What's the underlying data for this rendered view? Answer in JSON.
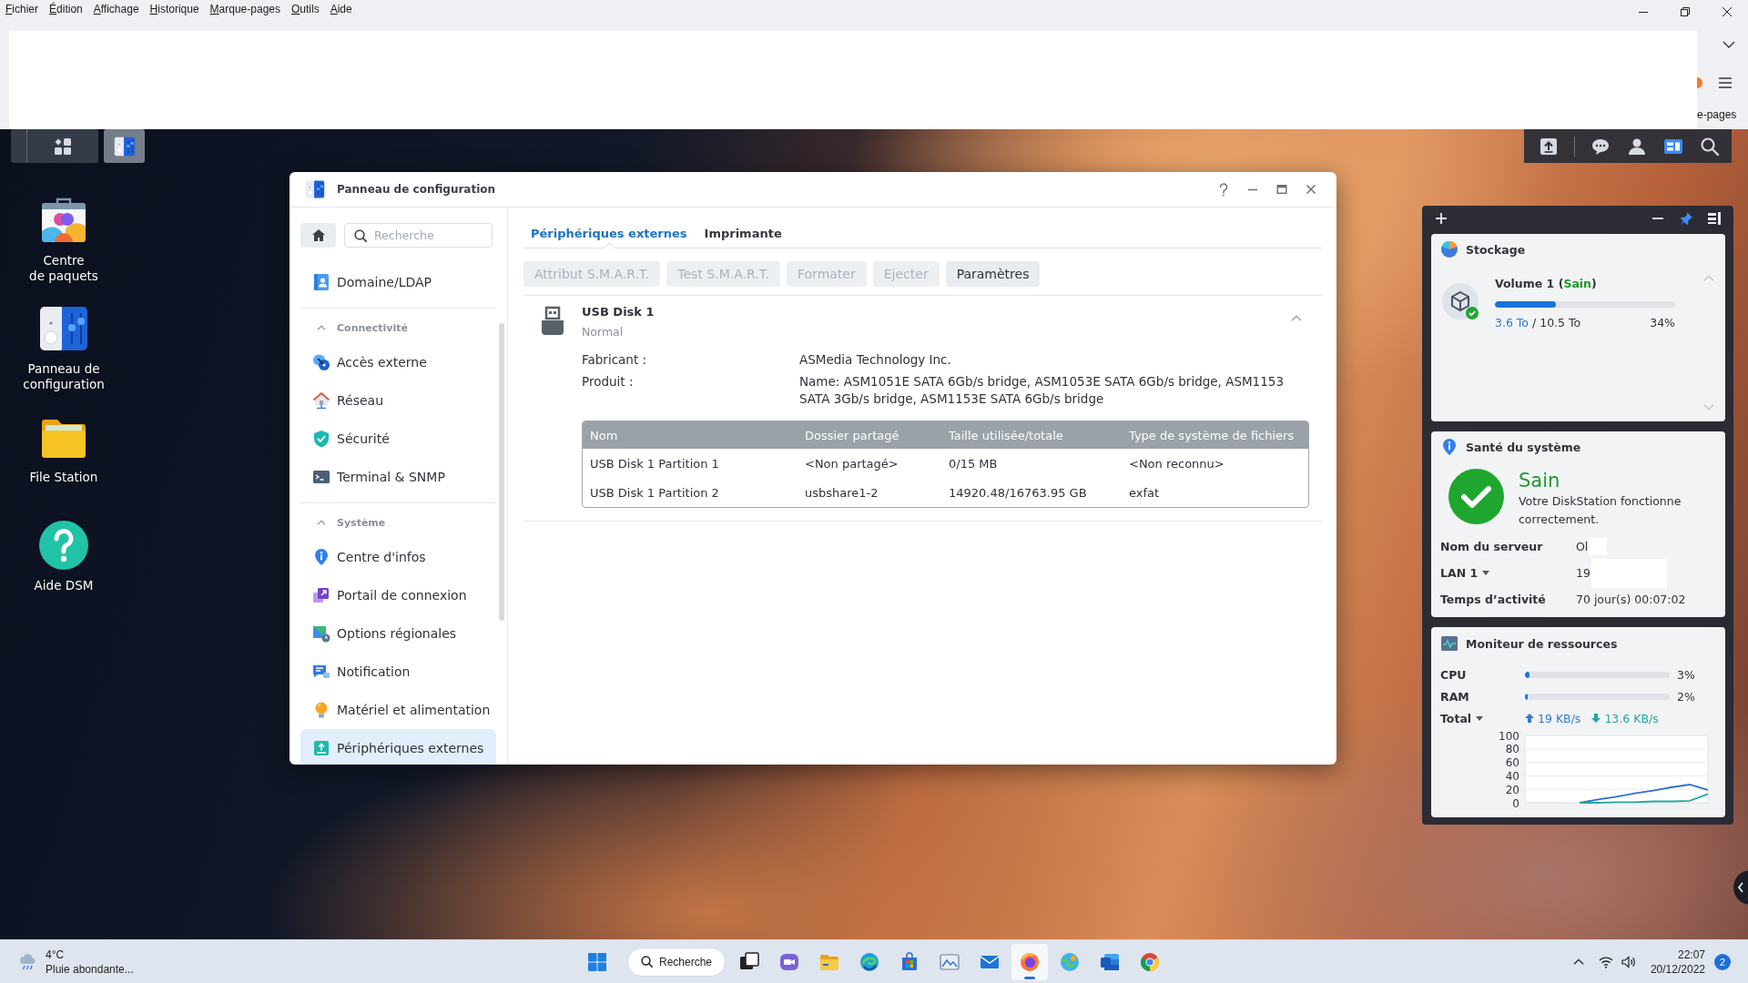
{
  "browser": {
    "menu": [
      "Fichier",
      "Édition",
      "Affichage",
      "Historique",
      "Marque-pages",
      "Outils",
      "Aide"
    ],
    "bookmarks_overflow": "e-pages"
  },
  "dsm_taskbar": {
    "open_windows": [
      {
        "active": true
      }
    ],
    "tray": [
      {
        "active": false
      },
      {
        "active": false
      },
      {
        "active": false
      },
      {
        "active": true
      },
      {
        "active": false
      }
    ]
  },
  "desktop_icons": [
    {
      "label": "Centre\nde paquets"
    },
    {
      "label": "Panneau de\nconfiguration"
    },
    {
      "label": "File Station"
    },
    {
      "label": "Aide DSM"
    }
  ],
  "control_panel": {
    "title": "Panneau de configuration",
    "search": {
      "placeholder": "Recherche"
    },
    "sidebar": [
      {
        "kind": "item",
        "label": "Domaine/LDAP",
        "selected": false
      },
      {
        "kind": "section",
        "label": "Connectivité",
        "expanded": true,
        "children": [
          {
            "label": "Accès externe",
            "selected": false
          },
          {
            "label": "Réseau",
            "selected": false
          },
          {
            "label": "Sécurité",
            "selected": false
          },
          {
            "label": "Terminal & SNMP",
            "selected": false
          }
        ]
      },
      {
        "kind": "section",
        "label": "Système",
        "expanded": true,
        "children": [
          {
            "label": "Centre d'infos",
            "selected": false
          },
          {
            "label": "Portail de connexion",
            "selected": false
          },
          {
            "label": "Options régionales",
            "selected": false
          },
          {
            "label": "Notification",
            "selected": false
          },
          {
            "label": "Matériel et alimentation",
            "selected": false
          },
          {
            "label": "Périphériques externes",
            "selected": true
          }
        ]
      }
    ],
    "tabs": [
      {
        "label": "Périphériques externes",
        "selected": true
      },
      {
        "label": "Imprimante",
        "selected": false
      }
    ],
    "toolbar": [
      {
        "label": "Attribut S.M.A.R.T.",
        "disabled": true
      },
      {
        "label": "Test S.M.A.R.T.",
        "disabled": true
      },
      {
        "label": "Formater",
        "disabled": true
      },
      {
        "label": "Ejecter",
        "disabled": true
      },
      {
        "label": "Paramètres",
        "disabled": false
      }
    ],
    "device": {
      "name": "USB Disk 1",
      "status": "Normal",
      "expanded": true,
      "details": [
        {
          "label": "Fabricant :",
          "value": "ASMedia Technology Inc."
        },
        {
          "label": "Produit :",
          "value": "Name: ASM1051E SATA 6Gb/s bridge, ASM1053E SATA 6Gb/s bridge, ASM1153 SATA 3Gb/s bridge, ASM1153E SATA 6Gb/s bridge"
        }
      ],
      "table": {
        "columns": [
          "Nom",
          "Dossier partagé",
          "Taille utilisée/totale",
          "Type de système de fichiers"
        ],
        "rows": [
          [
            "USB Disk 1 Partition 1",
            "<Non partagé>",
            "0/15 MB",
            "<Non reconnu>"
          ],
          [
            "USB Disk 1 Partition 2",
            "usbshare1-2",
            "14920.48/16763.95 GB",
            "exfat"
          ]
        ]
      }
    }
  },
  "widgets": {
    "storage": {
      "title": "Stockage",
      "volumes": [
        {
          "name": "Volume 1 (",
          "status": "Sain",
          "status_end": ")",
          "healthy": true,
          "level": 0.34,
          "used": "3.6 To",
          "separator": "/",
          "total": "10.5 To",
          "percent": "34%"
        }
      ]
    },
    "health": {
      "title": "Santé du système",
      "healthy": true,
      "status": "Sain",
      "message": "Votre DiskStation fonctionne correctement.",
      "info": [
        {
          "label": "Nom du serveur",
          "dropdown": false,
          "value": "Ol",
          "redacted": true
        },
        {
          "label": "LAN 1",
          "dropdown": true,
          "value": "19",
          "redacted": true
        },
        {
          "label": "Temps d’activité",
          "dropdown": false,
          "value": "70 jour(s) 00:07:02",
          "redacted": false
        }
      ]
    },
    "resources": {
      "title": "Moniteur de ressources",
      "meters": [
        {
          "label": "CPU",
          "level": 0.03,
          "reading": "3%"
        },
        {
          "label": "RAM",
          "level": 0.02,
          "reading": "2%"
        }
      ],
      "network": {
        "label": "Total",
        "upload": "19 KB/s",
        "download": "13.6 KB/s"
      },
      "chart_data": {
        "type": "line",
        "grid": true,
        "ylim": [
          0,
          100
        ],
        "yticks": [
          0,
          20,
          40,
          60,
          80,
          100
        ],
        "series": [
          {
            "color": "#2f6fd0",
            "values": [
              null,
              null,
              null,
              0,
              5,
              9,
              14,
              18,
              23,
              27,
              19
            ]
          },
          {
            "color": "#26a9a0",
            "values": [
              null,
              null,
              null,
              0,
              0,
              1,
              1,
              2,
              2,
              3,
              13
            ]
          }
        ]
      }
    }
  },
  "windows_taskbar": {
    "weather": {
      "temperature": "4°C",
      "condition": "Pluie abondante..."
    },
    "search_label": "Recherche",
    "apps": [
      {
        "active": false
      },
      {
        "active": false
      },
      {
        "active": false
      },
      {
        "active": false
      },
      {
        "active": false
      },
      {
        "active": false
      },
      {
        "active": false
      },
      {
        "active": true
      },
      {
        "active": false
      },
      {
        "active": false
      },
      {
        "active": false
      }
    ],
    "clock": {
      "time": "22:07",
      "date": "20/12/2022"
    },
    "notification_count": "2"
  }
}
